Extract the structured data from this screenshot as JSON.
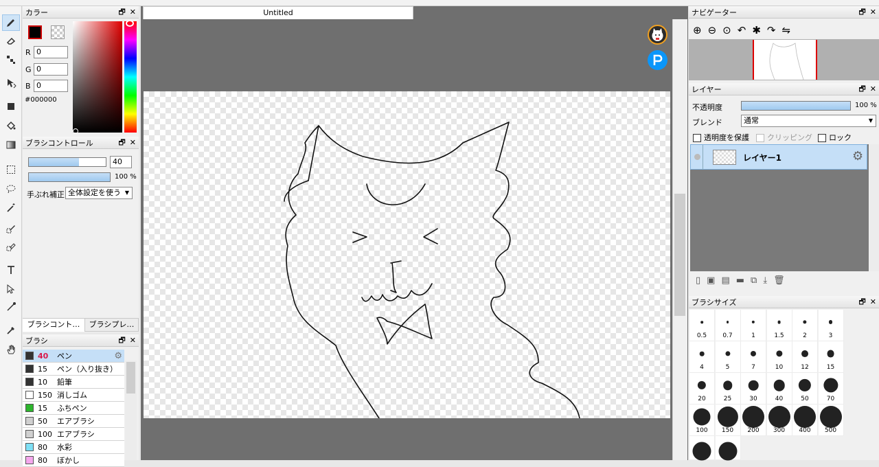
{
  "document": {
    "tab_title": "Untitled"
  },
  "color_panel": {
    "title": "カラー",
    "r_label": "R",
    "r_value": "0",
    "g_label": "G",
    "g_value": "0",
    "b_label": "B",
    "b_value": "0",
    "hex": "#000000",
    "foreground": "#000000"
  },
  "brush_control": {
    "title": "ブラシコントロール",
    "size_value": "40",
    "size_fraction": 0.65,
    "opacity_value": "100 %",
    "opacity_fraction": 1.0,
    "stabilizer_label": "手ぶれ補正",
    "stabilizer_value": "全体設定を使う",
    "tabs": [
      "ブラシコント…",
      "ブラシプレ…"
    ]
  },
  "brush_panel": {
    "title": "ブラシ",
    "items": [
      {
        "size": "40",
        "name": "ペン",
        "color": "#333333"
      },
      {
        "size": "15",
        "name": "ペン（入り抜き）",
        "color": "#333333"
      },
      {
        "size": "10",
        "name": "鉛筆",
        "color": "#333333"
      },
      {
        "size": "150",
        "name": "消しゴム",
        "color": "#ffffff"
      },
      {
        "size": "15",
        "name": "ふちペン",
        "color": "#2db52d"
      },
      {
        "size": "50",
        "name": "エアブラシ",
        "color": "#d0d0d0"
      },
      {
        "size": "100",
        "name": "エアブラシ",
        "color": "#d0d0d0"
      },
      {
        "size": "80",
        "name": "水彩",
        "color": "#7fe0f5"
      },
      {
        "size": "80",
        "name": "ぼかし",
        "color": "#f5a8ee"
      }
    ]
  },
  "navigator": {
    "title": "ナビゲーター"
  },
  "layer_panel": {
    "title": "レイヤー",
    "opacity_label": "不透明度",
    "opacity_value": "100 %",
    "opacity_fraction": 1.0,
    "blend_label": "ブレンド",
    "blend_value": "通常",
    "protect_label": "透明度を保護",
    "clipping_label": "クリッピング",
    "lock_label": "ロック",
    "layers": [
      {
        "name": "レイヤー1"
      }
    ]
  },
  "brush_size_panel": {
    "title": "ブラシサイズ",
    "sizes": [
      "0.5",
      "0.7",
      "1",
      "1.5",
      "2",
      "3",
      "4",
      "5",
      "7",
      "10",
      "12",
      "15",
      "20",
      "25",
      "30",
      "40",
      "50",
      "70",
      "100",
      "150",
      "200",
      "300",
      "400",
      "500"
    ]
  },
  "window_buttons": {
    "restore": "🗗",
    "close": "✕"
  },
  "colors": {
    "accent": "#c5dff7",
    "canvas_bg": "#6f6f6f",
    "brush_size_highlight": "#d9194a"
  }
}
